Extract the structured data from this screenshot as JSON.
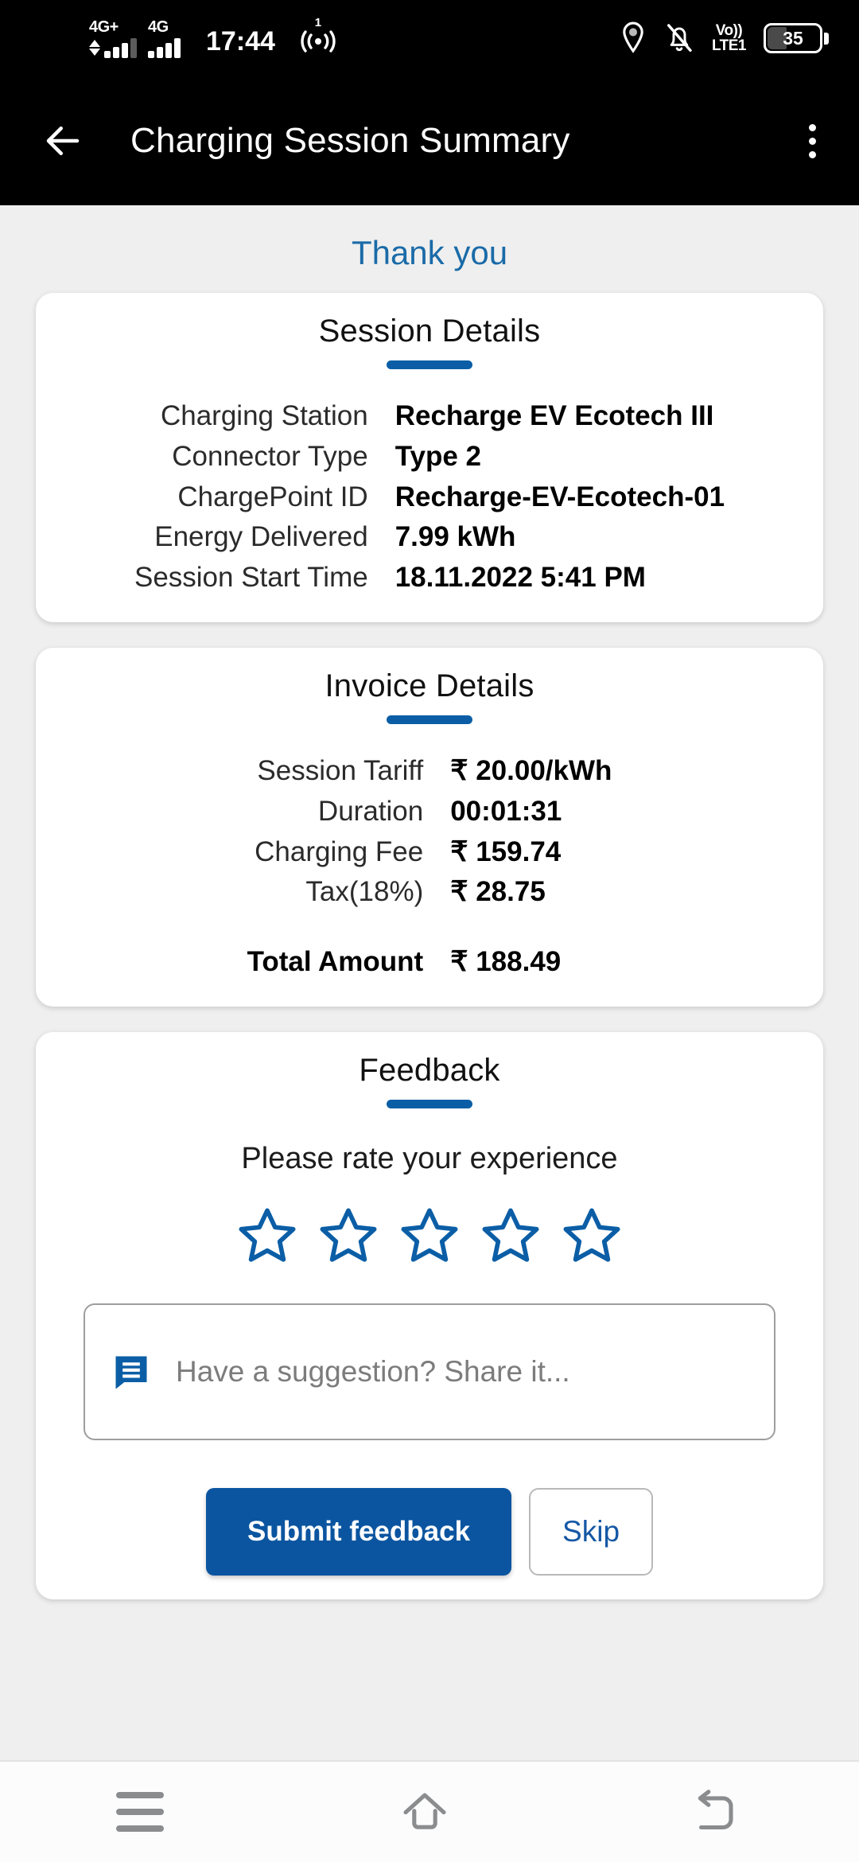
{
  "statusbar": {
    "sim1_label": "4G+",
    "sim2_label": "4G",
    "time": "17:44",
    "hotspot_sup": "1",
    "volte_line1": "Vo))",
    "volte_line2": "LTE1",
    "battery_percent": "35",
    "icons": [
      "location-pin-icon",
      "bell-muted-icon",
      "volte-icon",
      "battery-icon"
    ]
  },
  "appbar": {
    "back_icon": "back-arrow-icon",
    "title": "Charging Session Summary",
    "overflow_icon": "kebab-menu-icon"
  },
  "page": {
    "thank_you": "Thank you"
  },
  "session_details": {
    "title": "Session Details",
    "rows": [
      {
        "label": "Charging Station",
        "value": "Recharge EV Ecotech III"
      },
      {
        "label": "Connector Type",
        "value": "Type 2"
      },
      {
        "label": "ChargePoint ID",
        "value": "Recharge-EV-Ecotech-01"
      },
      {
        "label": "Energy Delivered",
        "value": "7.99 kWh"
      },
      {
        "label": "Session Start Time",
        "value": "18.11.2022 5:41 PM"
      }
    ]
  },
  "invoice_details": {
    "title": "Invoice Details",
    "rows": [
      {
        "label": "Session Tariff",
        "value": "₹ 20.00/kWh"
      },
      {
        "label": "Duration",
        "value": "00:01:31"
      },
      {
        "label": "Charging Fee",
        "value": "₹ 159.74"
      },
      {
        "label": "Tax(18%)",
        "value": "₹ 28.75"
      }
    ],
    "total": {
      "label": "Total Amount",
      "value": "₹ 188.49"
    }
  },
  "feedback": {
    "title": "Feedback",
    "prompt": "Please rate your experience",
    "rating_value": 0,
    "rating_max": 5,
    "star_icon": "star-outline-icon",
    "suggestion_icon": "chat-message-icon",
    "suggestion_value": "",
    "suggestion_placeholder": "Have a suggestion? Share it...",
    "submit_label": "Submit feedback",
    "skip_label": "Skip"
  },
  "navbar": {
    "recents_icon": "hamburger-recents-icon",
    "home_icon": "home-icon",
    "back_icon": "back-nav-icon"
  },
  "colors": {
    "accent_blue": "#0b5ea6",
    "button_blue": "#0b55a0",
    "thankyou_blue": "#1a6ba8",
    "page_bg": "#efefef",
    "card_bg": "#ffffff",
    "statusbar_bg": "#000000"
  }
}
